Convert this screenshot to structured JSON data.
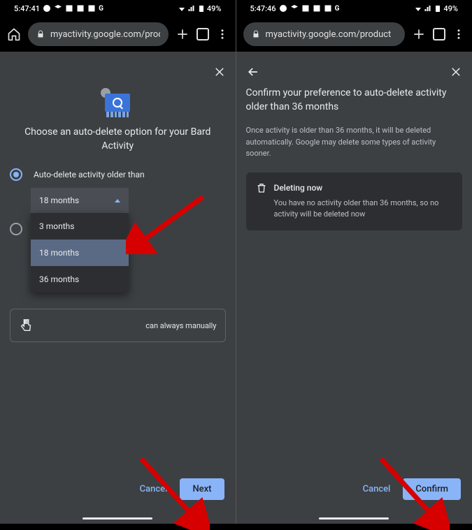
{
  "status": {
    "time_left": "5:47:41",
    "time_right": "5:47:46",
    "battery": "49%"
  },
  "browser": {
    "url": "myactivity.google.com/product"
  },
  "screen1": {
    "title": "Choose an auto-delete option for your Bard Activity",
    "radio1_label": "Auto-delete activity older than",
    "dropdown_selected": "18 months",
    "dropdown_options": [
      "3 months",
      "18 months",
      "36 months"
    ],
    "hint_text": "can always manually",
    "cancel": "Cancel",
    "next": "Next"
  },
  "screen2": {
    "title": "Confirm your preference to auto-delete activity older than 36 months",
    "subtext": "Once activity is older than 36 months, it will be deleted automatically. Google may delete some types of activity sooner.",
    "card_title": "Deleting now",
    "card_body": "You have no activity older than 36 months, so no activity will be deleted now",
    "cancel": "Cancel",
    "confirm": "Confirm"
  }
}
